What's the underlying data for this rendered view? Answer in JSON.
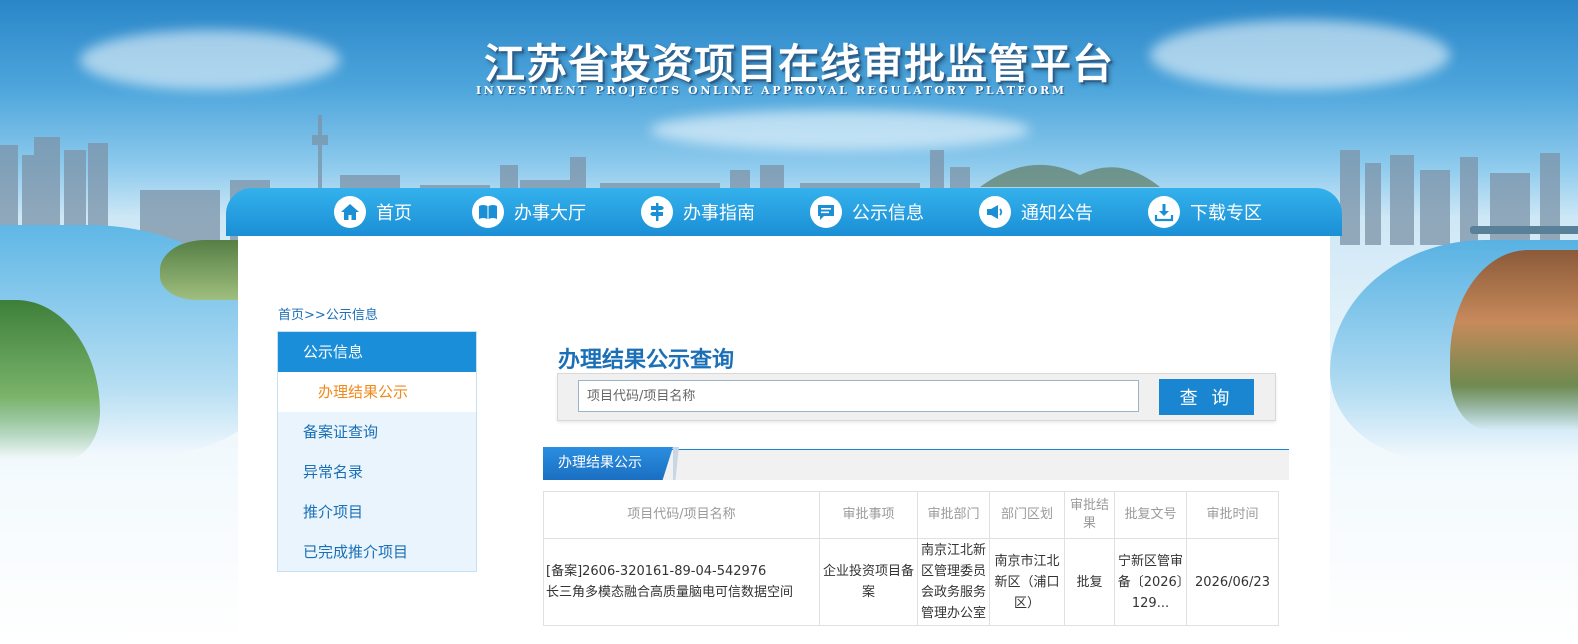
{
  "header": {
    "title": "江苏省投资项目在线审批监管平台",
    "subtitle": "INVESTMENT PROJECTS ONLINE APPROVAL REGULATORY PLATFORM"
  },
  "nav": {
    "items": [
      {
        "label": "首页",
        "icon": "home-icon"
      },
      {
        "label": "办事大厅",
        "icon": "book-icon"
      },
      {
        "label": "办事指南",
        "icon": "signpost-icon"
      },
      {
        "label": "公示信息",
        "icon": "chat-list-icon"
      },
      {
        "label": "通知公告",
        "icon": "megaphone-icon"
      },
      {
        "label": "下载专区",
        "icon": "download-icon"
      }
    ]
  },
  "breadcrumb": {
    "home": "首页",
    "separator": ">>",
    "current": "公示信息"
  },
  "sidebar": {
    "header": "公示信息",
    "active_sub": "办理结果公示",
    "items": [
      "备案证查询",
      "异常名录",
      "推介项目",
      "已完成推介项目"
    ]
  },
  "search": {
    "title": "办理结果公示查询",
    "placeholder": "项目代码/项目名称",
    "button": "查 询"
  },
  "results": {
    "tab_label": "办理结果公示",
    "columns": [
      "项目代码/项目名称",
      "审批事项",
      "审批部门",
      "部门区划",
      "审批结果",
      "批复文号",
      "审批时间"
    ],
    "rows": [
      {
        "code": "[备案]2606-320161-89-04-542976",
        "name": "长三角多模态融合高质量脑电可信数据空间",
        "matter": "企业投资项目备案",
        "department": "南京江北新区管理委员会政务服务管理办公室",
        "region": "南京市江北新区（浦口区）",
        "result": "批复",
        "doc_no": "宁新区管审备〔2026〕129...",
        "date": "2026/06/23"
      }
    ]
  },
  "colors": {
    "nav_blue": "#1b8fd6",
    "link_blue": "#1a6fb6",
    "active_orange": "#f08a1c",
    "button_blue": "#1a86d1"
  }
}
